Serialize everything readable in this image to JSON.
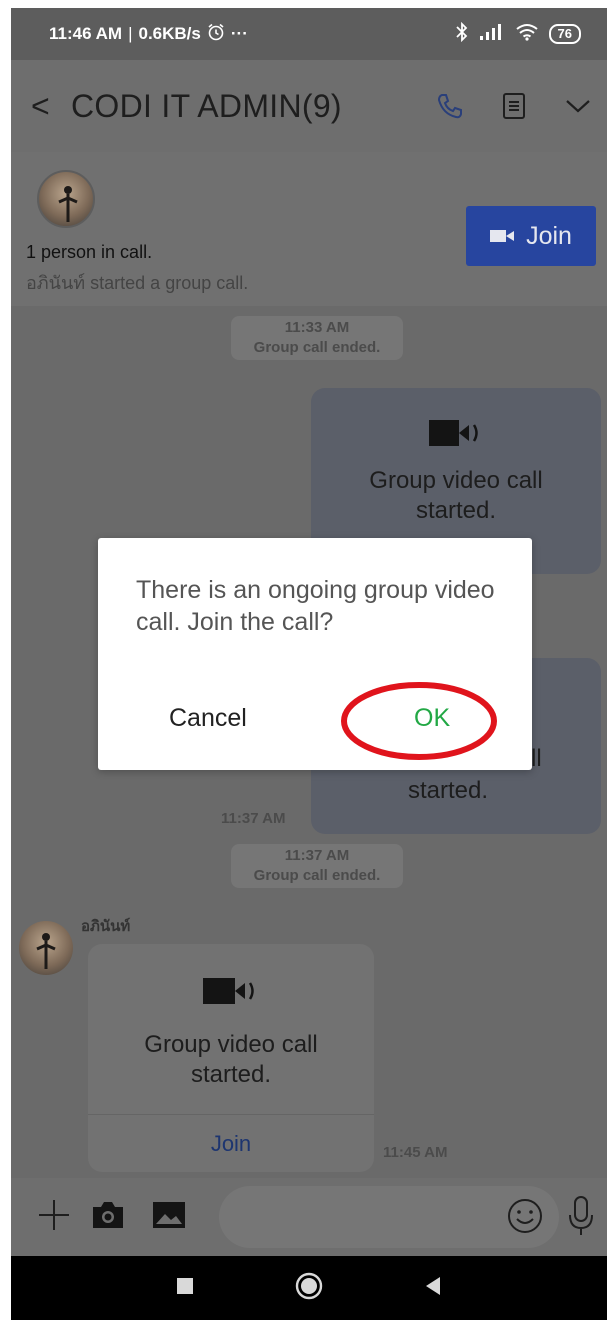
{
  "status_bar": {
    "time": "11:46 AM",
    "separator": "|",
    "speed": "0.6KB/s",
    "more": "···",
    "battery": "76"
  },
  "header": {
    "back": "<",
    "title": "CODI IT ADMIN(9)"
  },
  "call_banner": {
    "people": "1 person in call.",
    "started": "อภินันท์ started a group call.",
    "join_label": "Join"
  },
  "chat": {
    "ended_1_time": "11:33 AM",
    "ended_1_text": "Group call ended.",
    "bubble_1_text": "Group video call started.",
    "bubble_2_partial": "ll",
    "bubble_2_partial2": "started.",
    "time_1137": "11:37 AM",
    "ended_2_time": "11:37 AM",
    "ended_2_text": "Group call ended.",
    "sender_name": "อภินันท์",
    "bubble_3_text": "Group video call started.",
    "bubble_3_join": "Join",
    "time_1145": "11:45 AM"
  },
  "input": {
    "placeholder": ""
  },
  "dialog": {
    "message": "There is an ongoing group video call. Join the call?",
    "cancel_label": "Cancel",
    "ok_label": "OK"
  },
  "colors": {
    "accent_blue": "#27459f",
    "ok_green": "#22a845",
    "annotation_red": "#e0141c"
  }
}
